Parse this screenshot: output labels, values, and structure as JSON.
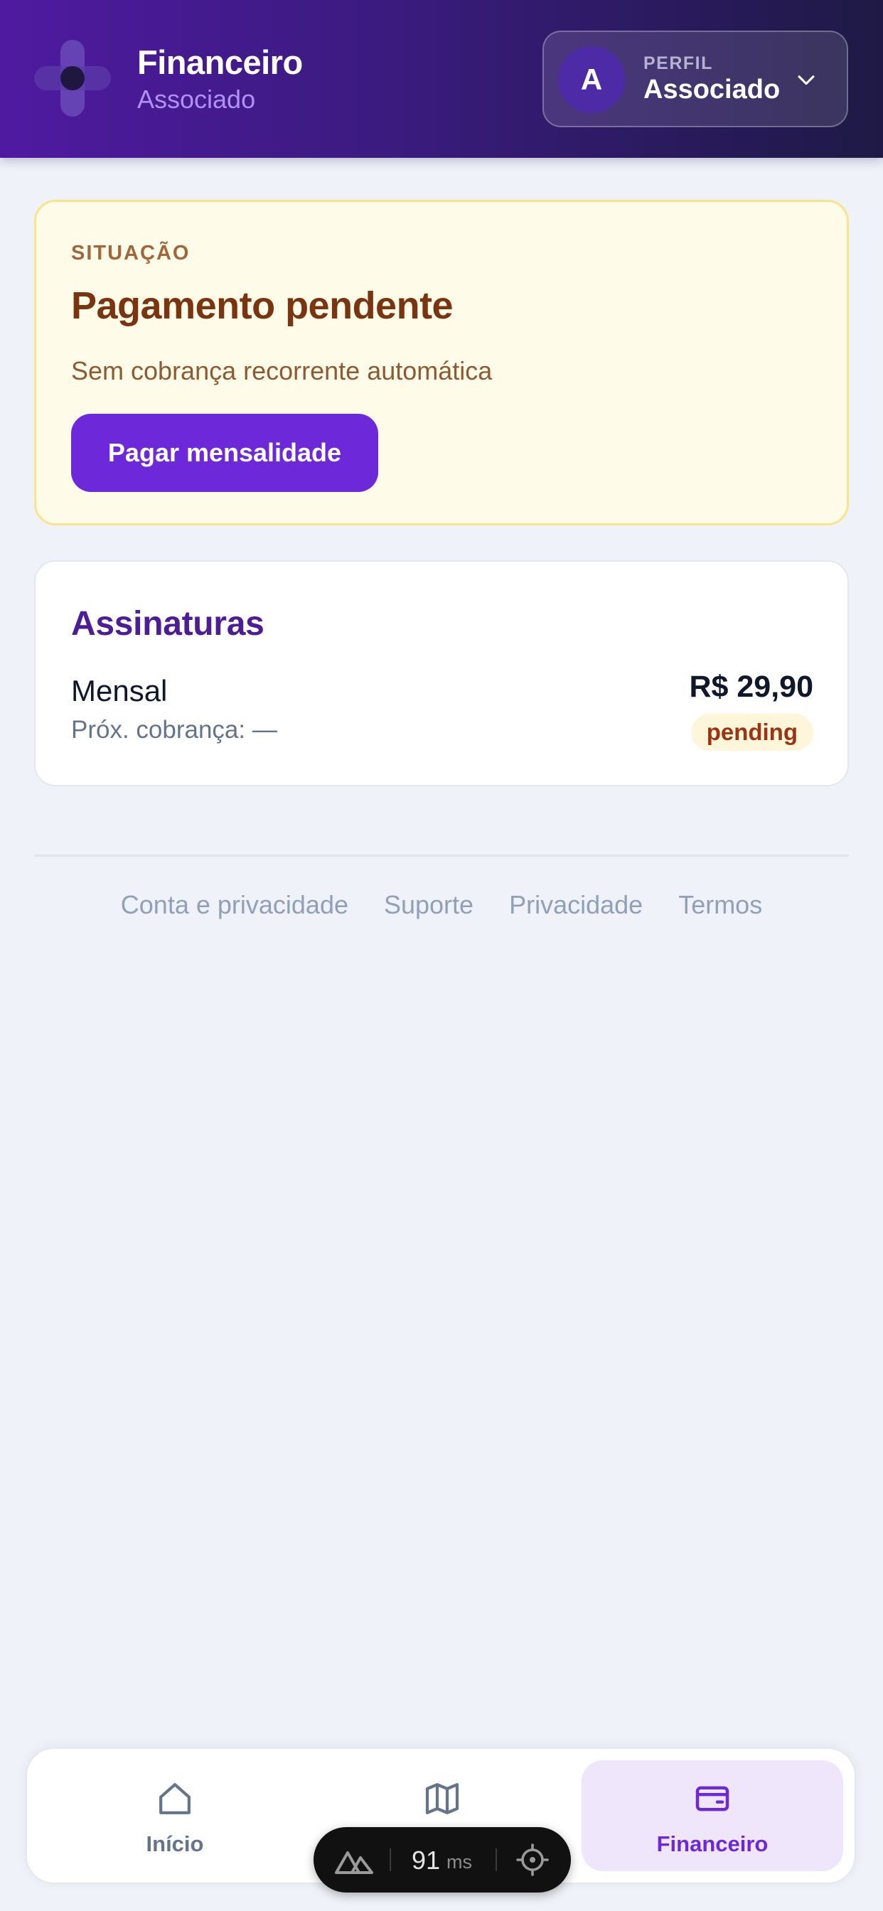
{
  "header": {
    "title": "Financeiro",
    "subtitle": "Associado",
    "profile": {
      "avatar_initial": "A",
      "label": "PERFIL",
      "name": "Associado"
    }
  },
  "status": {
    "label": "SITUAÇÃO",
    "title": "Pagamento pendente",
    "description": "Sem cobrança recorrente automática",
    "button_label": "Pagar mensalidade"
  },
  "subscriptions": {
    "title": "Assinaturas",
    "items": [
      {
        "plan": "Mensal",
        "next_charge": "Próx. cobrança: —",
        "price": "R$ 29,90",
        "status": "pending"
      }
    ]
  },
  "footer": {
    "links": [
      "Conta e privacidade",
      "Suporte",
      "Privacidade",
      "Termos"
    ]
  },
  "bottom_nav": {
    "items": [
      {
        "label": "Início",
        "icon": "home-icon",
        "active": false
      },
      {
        "label": "",
        "icon": "map-icon",
        "active": false
      },
      {
        "label": "Financeiro",
        "icon": "wallet-icon",
        "active": true
      }
    ]
  },
  "dev_overlay": {
    "value": "91",
    "unit": "ms"
  },
  "colors": {
    "brand": "#6d28d9",
    "header_start": "#4f1aa0",
    "header_end": "#1e1a45",
    "warning_bg": "#fefbe9",
    "warning_border": "#fbe38e",
    "warning_title": "#7a3410",
    "active_nav_bg": "#efe6fb"
  }
}
